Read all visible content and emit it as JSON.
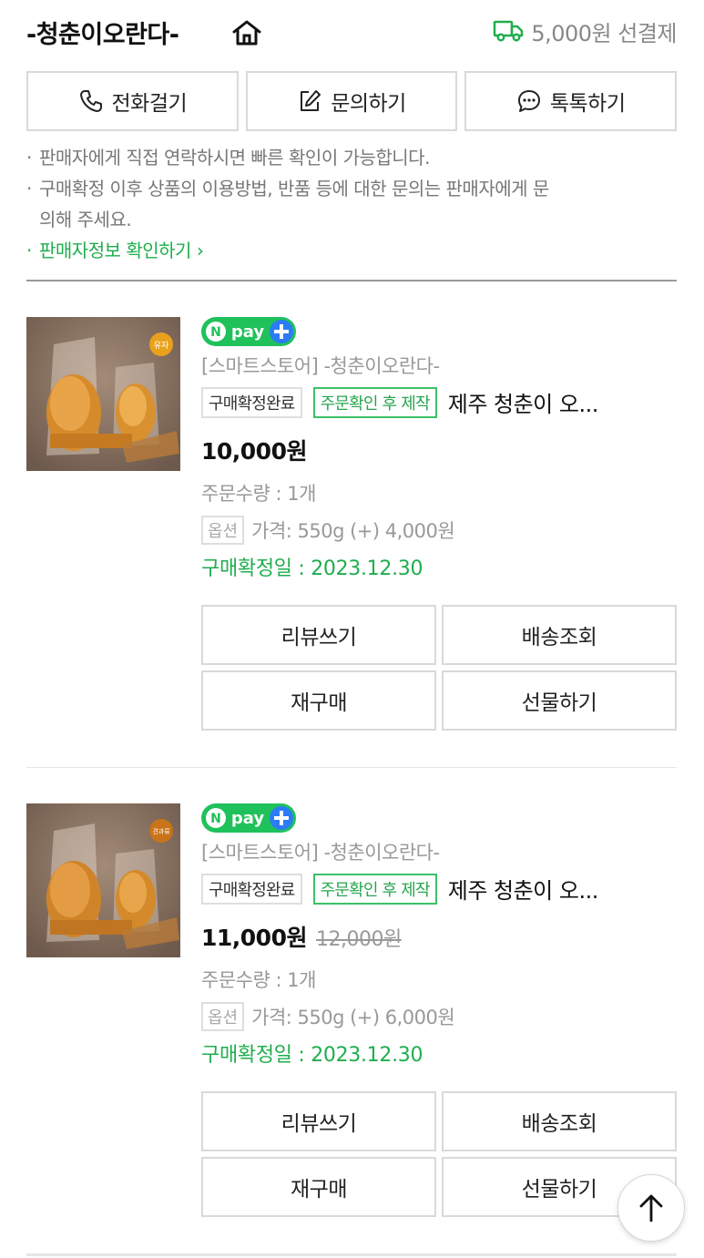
{
  "header": {
    "store_name": "-청춘이오란다-",
    "shipping": "5,000원 선결제",
    "accent_color": "#1fae4d"
  },
  "contact": {
    "call_label": "전화걸기",
    "inquiry_label": "문의하기",
    "talk_label": "톡톡하기"
  },
  "notes": {
    "line1": "판매자에게 직접 연락하시면 빠른 확인이 가능합니다.",
    "line2a": "구매확정 이후 상품의 이용방법, 반품 등에 대한 문의는 판매자에게 문",
    "line2b": "의해 주세요.",
    "seller_info_link": "판매자정보 확인하기"
  },
  "orders": [
    {
      "thumb_badge": "유자",
      "npay": "pay",
      "seller": "[스마트스토어] -청춘이오란다-",
      "status_tag": "구매확정완료",
      "made_tag": "주문확인 후 제작",
      "product_name": "제주 청춘이 오...",
      "price": "10,000원",
      "old_price": "",
      "quantity": "주문수량 : 1개",
      "option_tag": "옵션",
      "option_text": "가격: 550g (+) 4,000원",
      "confirm_date": "구매확정일 : 2023.12.30",
      "buttons": {
        "review": "리뷰쓰기",
        "delivery": "배송조회",
        "rebuy": "재구매",
        "gift": "선물하기"
      }
    },
    {
      "thumb_badge": "견과류",
      "npay": "pay",
      "seller": "[스마트스토어] -청춘이오란다-",
      "status_tag": "구매확정완료",
      "made_tag": "주문확인 후 제작",
      "product_name": "제주 청춘이 오...",
      "price": "11,000원",
      "old_price": "12,000원",
      "quantity": "주문수량 : 1개",
      "option_tag": "옵션",
      "option_text": "가격: 550g (+) 6,000원",
      "confirm_date": "구매확정일 : 2023.12.30",
      "buttons": {
        "review": "리뷰쓰기",
        "delivery": "배송조회",
        "rebuy": "재구매",
        "gift": "선물하기"
      }
    }
  ]
}
